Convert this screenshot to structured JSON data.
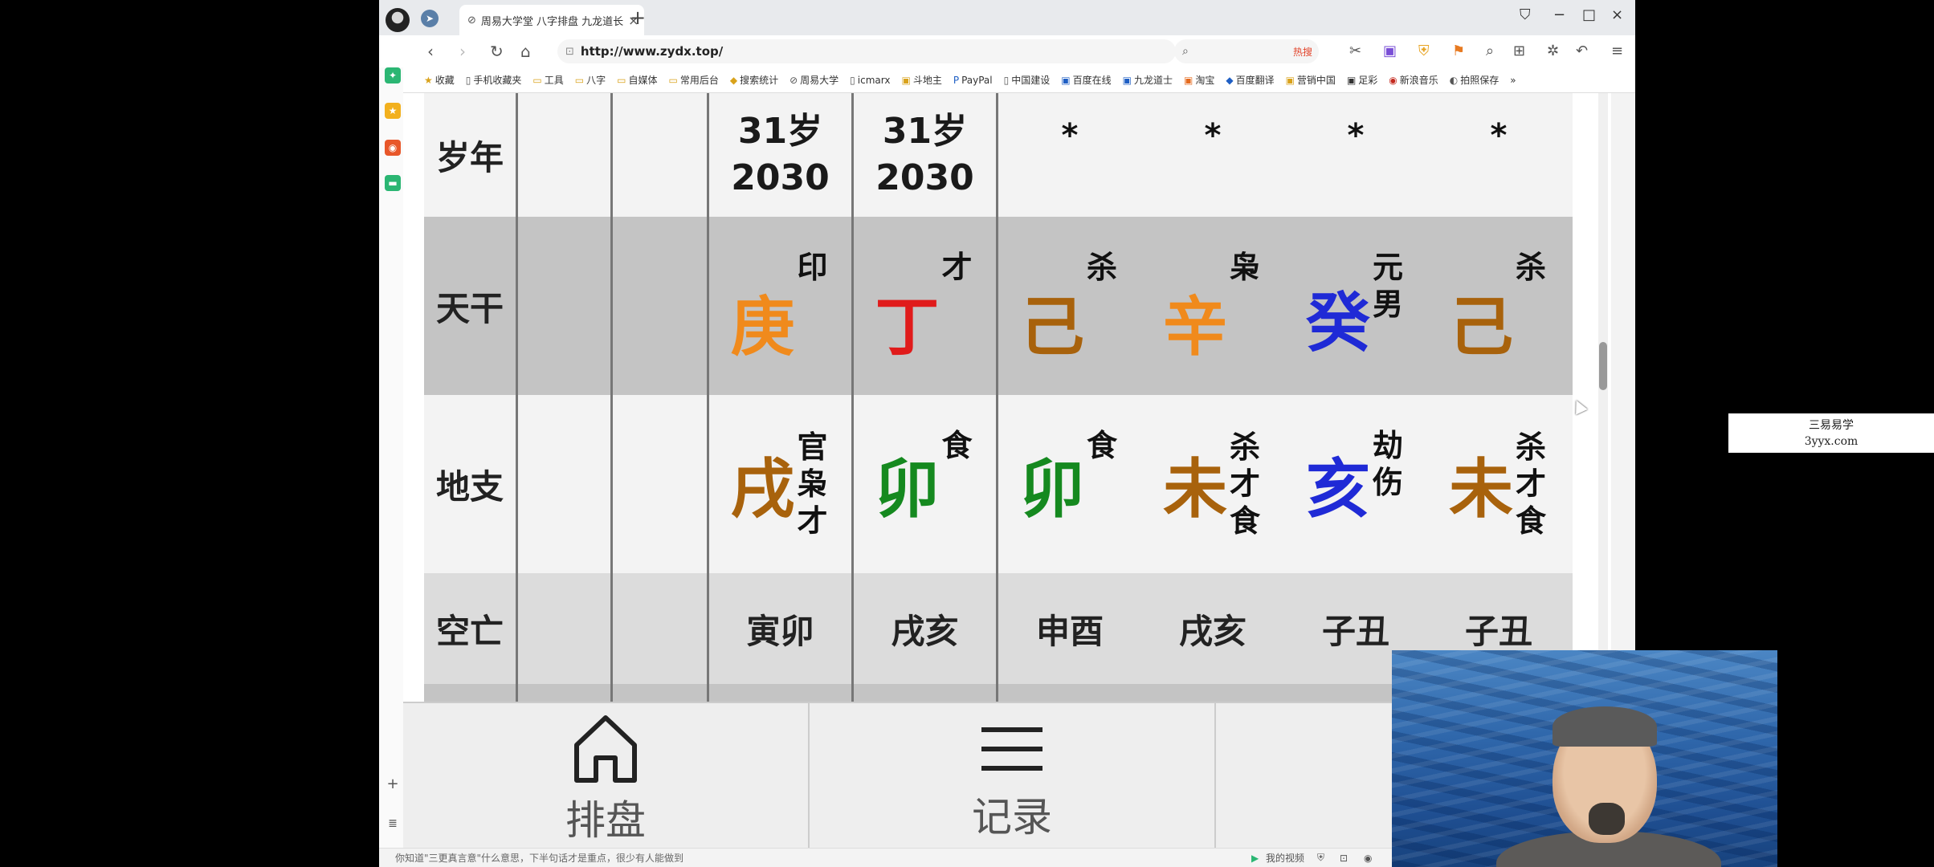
{
  "browser": {
    "tab_title": "周易大学堂 八字排盘 九龙道长",
    "url": "http://www.zydx.top/",
    "search_hot": "热搜",
    "bookmarks": [
      "收藏",
      "手机收藏夹",
      "工具",
      "八字",
      "自媒体",
      "常用后台",
      "搜索统计",
      "周易大学",
      "icmarx",
      "斗地主",
      "PayPal",
      "中国建设",
      "百度在线",
      "九龙道士",
      "淘宝",
      "百度翻译",
      "营销中国",
      "足彩",
      "新浪音乐",
      "拍照保存"
    ],
    "status_text": "你知道\"三更真言意\"什么意思，下半句话才是重点，很少有人能做到",
    "status_right": "我的视频"
  },
  "chart": {
    "rows": {
      "sui_nian": "岁年",
      "tian_gan": "天干",
      "di_zhi": "地支",
      "kong_wang": "空亡"
    },
    "columns": [
      {
        "age": "31岁",
        "year": "2030",
        "gan": "庚",
        "gan_color": "#f08a1c",
        "gan_god": "印",
        "zhi": "戌",
        "zhi_color": "#a8620c",
        "zhi_gods": "官枭才",
        "kong": "寅卯"
      },
      {
        "age": "31岁",
        "year": "2030",
        "gan": "丁",
        "gan_color": "#e01b1b",
        "gan_god": "才",
        "zhi": "卯",
        "zhi_color": "#15891f",
        "zhi_gods": "食",
        "kong": "戌亥"
      },
      {
        "age": "",
        "year": "*",
        "gan": "己",
        "gan_color": "#a8620c",
        "gan_god": "杀",
        "zhi": "卯",
        "zhi_color": "#15891f",
        "zhi_gods": "食",
        "kong": "申酉"
      },
      {
        "age": "",
        "year": "*",
        "gan": "辛",
        "gan_color": "#f08a1c",
        "gan_god": "枭",
        "zhi": "未",
        "zhi_color": "#a8620c",
        "zhi_gods": "杀才食",
        "kong": "戌亥"
      },
      {
        "age": "",
        "year": "*",
        "gan": "癸",
        "gan_color": "#1f2ad6",
        "gan_god": "元男",
        "zhi": "亥",
        "zhi_color": "#1f2ad6",
        "zhi_gods": "劫伤",
        "kong": "子丑"
      },
      {
        "age": "",
        "year": "*",
        "gan": "己",
        "gan_color": "#a8620c",
        "gan_god": "杀",
        "zhi": "未",
        "zhi_color": "#a8620c",
        "zhi_gods": "杀才食",
        "kong": "子丑"
      }
    ]
  },
  "bottom_nav": {
    "home_label": "排盘",
    "records_label": "记录"
  },
  "watermark": {
    "line1": "三易易学",
    "line2": "3yyx.com"
  }
}
